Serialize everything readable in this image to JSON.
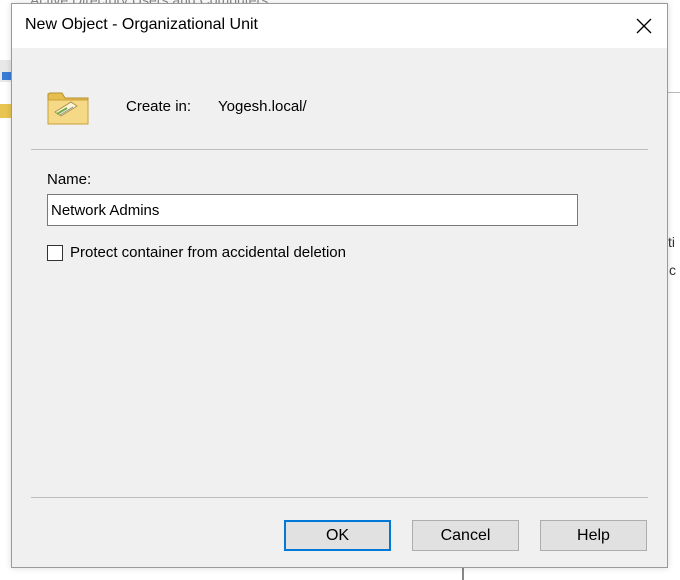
{
  "background": {
    "title": "Active Directory Users and Computers",
    "frag_a": "ti",
    "frag_b": "c"
  },
  "dialog": {
    "title": "New Object - Organizational Unit",
    "close_icon": "close-icon",
    "folder_icon": "ou-folder-icon",
    "create_in_label": "Create in:",
    "create_in_value": "Yogesh.local/",
    "name_label": "Name:",
    "name_value": "Network Admins",
    "protect_label": "Protect container from accidental deletion",
    "protect_checked": false,
    "buttons": {
      "ok": "OK",
      "cancel": "Cancel",
      "help": "Help"
    }
  },
  "colors": {
    "dialog_bg": "#f0f0f0",
    "titlebar_bg": "#ffffff",
    "default_button_border": "#0078d7",
    "folder_yellow": "#f2d27a"
  }
}
